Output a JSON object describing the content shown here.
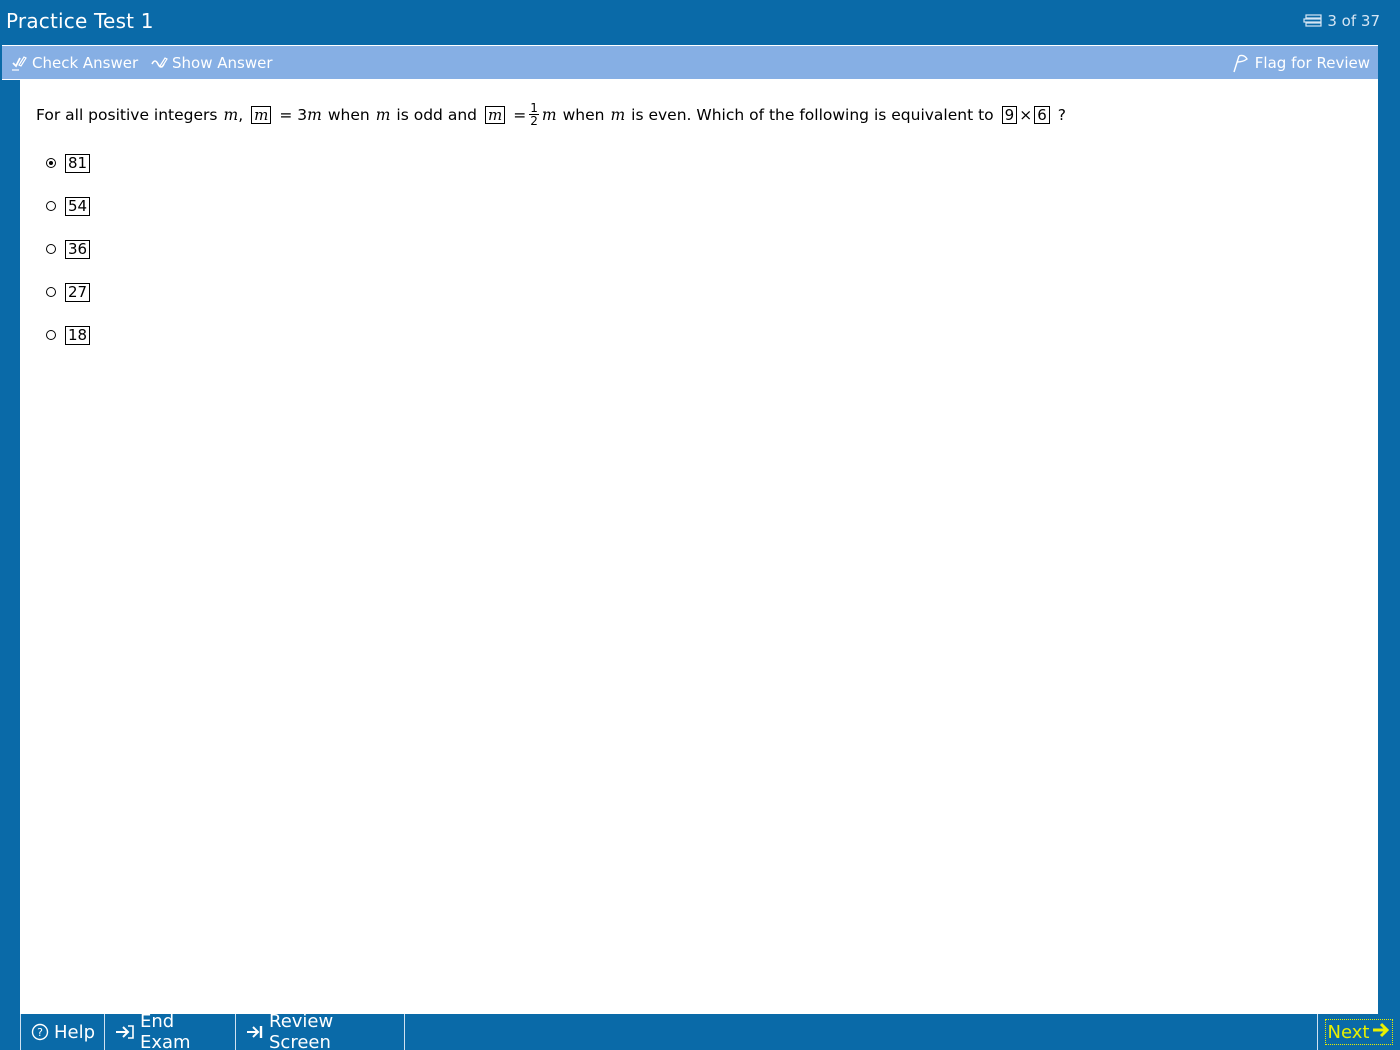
{
  "title": "Practice Test 1",
  "counter": {
    "text": "3 of 37",
    "icon": "question-stack-icon"
  },
  "toolbar": {
    "check_answer": {
      "label": "Check Answer",
      "icon": "check-pen-icon"
    },
    "show_answer": {
      "label": "Show Answer",
      "icon": "show-pen-icon"
    },
    "flag_review": {
      "label": "Flag for Review",
      "icon": "flag-icon"
    }
  },
  "question": {
    "p1": "For all positive integers",
    "var_m": "m",
    "comma": ",",
    "box_m": "m",
    "eq1": "= 3",
    "p2": "when",
    "p3": "is odd and",
    "eq2": "=",
    "frac_num": "1",
    "frac_den": "2",
    "p4": "when",
    "p5": "is even.  Which of the following is equivalent to",
    "box_9": "9",
    "times": "×",
    "box_6": "6",
    "qmark": "?"
  },
  "choices": [
    {
      "label": "81",
      "selected": true
    },
    {
      "label": "54",
      "selected": false
    },
    {
      "label": "36",
      "selected": false
    },
    {
      "label": "27",
      "selected": false
    },
    {
      "label": "18",
      "selected": false
    }
  ],
  "bottom": {
    "help": "Help",
    "end_exam": "End Exam",
    "review_screen": "Review Screen",
    "next": "Next"
  },
  "colors": {
    "frame_blue": "#0a6aa8",
    "toolbar_blue": "#86afe4",
    "next_yellow": "#e8f000"
  }
}
